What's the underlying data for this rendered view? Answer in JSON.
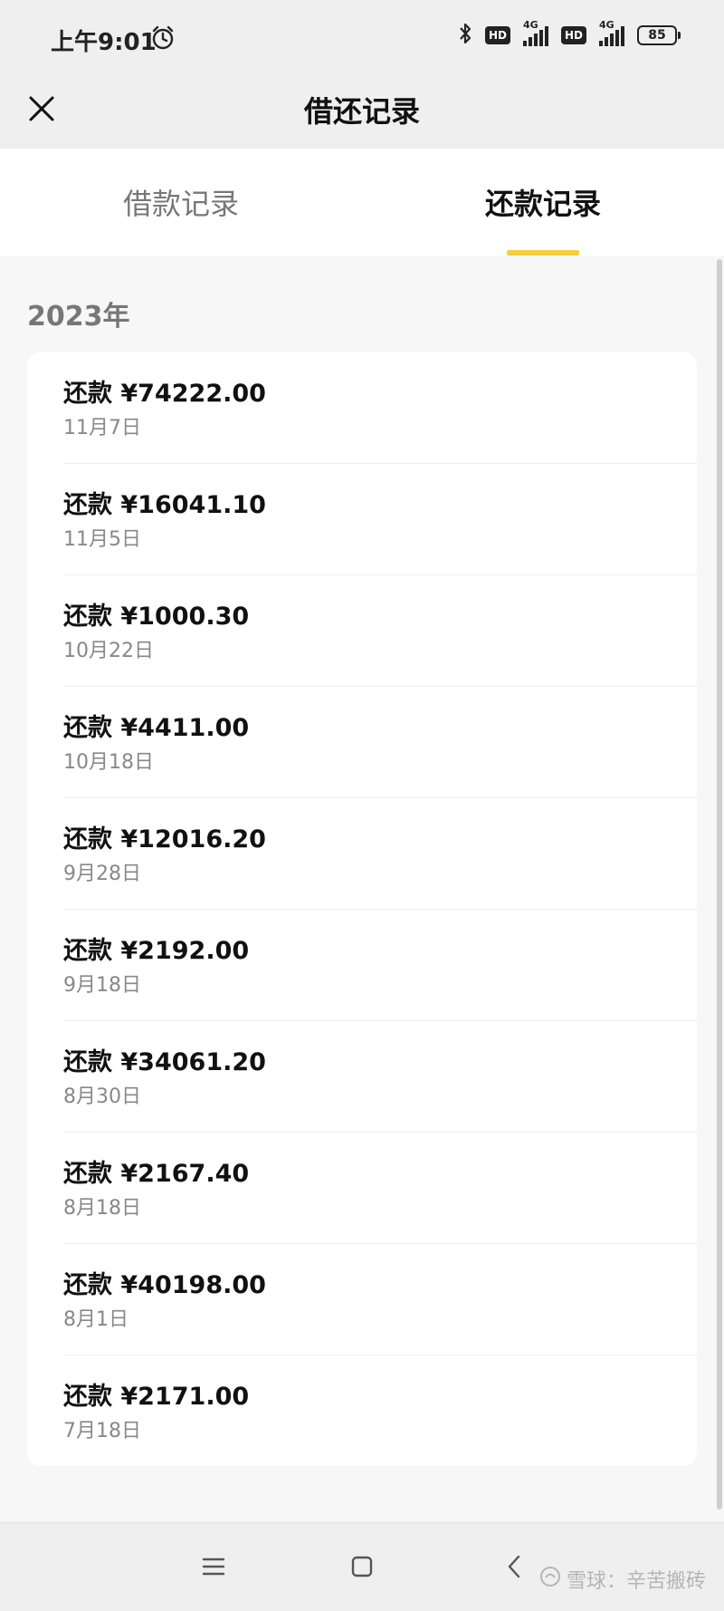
{
  "status_bar": {
    "time": "上午9:01",
    "hd_label": "HD",
    "network_label": "4G",
    "battery_level": "85"
  },
  "header": {
    "title": "借还记录"
  },
  "tabs": [
    {
      "label": "借款记录",
      "active": false
    },
    {
      "label": "还款记录",
      "active": true
    }
  ],
  "year": "2023年",
  "records": [
    {
      "title": "还款 ¥74222.00",
      "date": "11月7日"
    },
    {
      "title": "还款 ¥16041.10",
      "date": "11月5日"
    },
    {
      "title": "还款 ¥1000.30",
      "date": "10月22日"
    },
    {
      "title": "还款 ¥4411.00",
      "date": "10月18日"
    },
    {
      "title": "还款 ¥12016.20",
      "date": "9月28日"
    },
    {
      "title": "还款 ¥2192.00",
      "date": "9月18日"
    },
    {
      "title": "还款 ¥34061.20",
      "date": "8月30日"
    },
    {
      "title": "还款 ¥2167.40",
      "date": "8月18日"
    },
    {
      "title": "还款 ¥40198.00",
      "date": "8月1日"
    },
    {
      "title": "还款 ¥2171.00",
      "date": "7月18日"
    }
  ],
  "watermark": "雪球：辛苦搬砖",
  "colors": {
    "accent": "#f2cf3c",
    "background": "#f7f7f7",
    "card": "#ffffff"
  },
  "icons": {
    "close": "close-icon",
    "alarm": "alarm-icon",
    "bluetooth": "bluetooth-icon",
    "menu": "menu-icon",
    "home": "home-icon",
    "back": "back-icon"
  }
}
